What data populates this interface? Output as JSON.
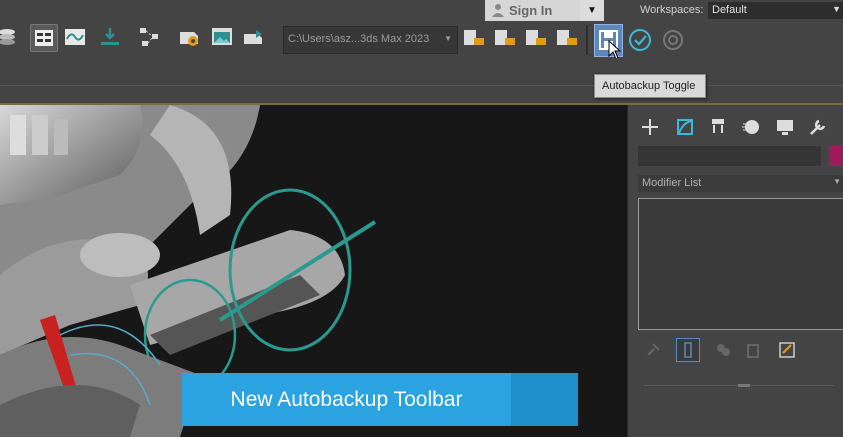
{
  "auth": {
    "sign_in_label": "Sign In"
  },
  "workspaces": {
    "label": "Workspaces:",
    "selected": "Default"
  },
  "toolbar": {
    "project_path": "C:\\Users\\asz...3ds Max 2023"
  },
  "autobackup_toolbar": {
    "tooltip": "Autobackup Toggle"
  },
  "command_panel": {
    "modifier_list_label": "Modifier List",
    "object_color": "#9e1a5a"
  },
  "banner": {
    "text": "New Autobackup Toolbar",
    "color": "#2aa3e0"
  },
  "icons": [
    "user-icon",
    "dropdown-arrow-icon",
    "layers-icon",
    "layout-icon",
    "curve-editor-icon",
    "render-to-texture-icon",
    "schematic-view-icon",
    "render-setup-icon",
    "rendered-frame-icon",
    "render-icon",
    "folder-icon",
    "autobackup-save-icon",
    "check-icon",
    "autobackup-settings-icon",
    "cursor-icon",
    "create-icon",
    "modify-icon",
    "hierarchy-icon",
    "motion-icon",
    "display-icon",
    "utilities-icon"
  ]
}
